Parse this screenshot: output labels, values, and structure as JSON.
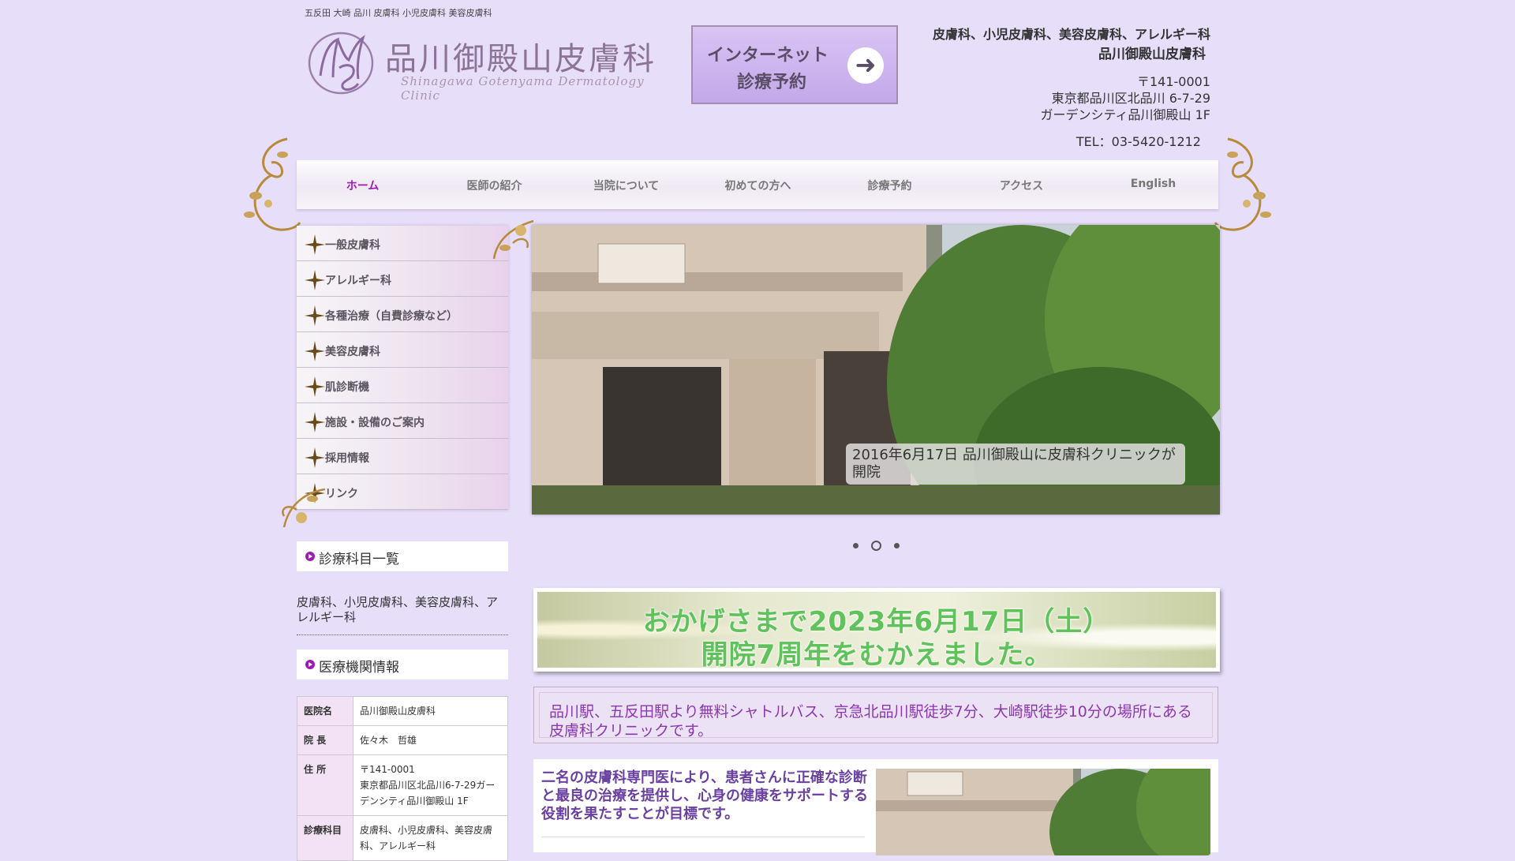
{
  "header": {
    "keywords": "五反田 大崎 品川 皮膚科 小児皮膚科 美容皮膚科",
    "logo_name": "品川御殿山皮膚科",
    "logo_sub": "Shinagawa Gotenyama Dermatology Clinic",
    "reserve_line1": "インターネット",
    "reserve_line2": "診療予約",
    "reserve_arrow": "➜",
    "depts": "皮膚科、小児皮膚科、美容皮膚科、アレルギー科",
    "clinic_name": "品川御殿山皮膚科",
    "postal": "〒141-0001",
    "address1": "東京都品川区北品川 6-7-29",
    "address2": "ガーデンシティ品川御殿山 1F",
    "tel": "TEL：03-5420-1212"
  },
  "nav": {
    "items": [
      "ホーム",
      "医師の紹介",
      "当院について",
      "初めての方へ",
      "診療予約",
      "アクセス",
      "English"
    ],
    "active_index": 0
  },
  "side_menu": {
    "items": [
      "一般皮膚科",
      "アレルギー科",
      "各種治療（自費診療など）",
      "美容皮膚科",
      "肌診断機",
      "施設・設備のご案内",
      "採用情報",
      "リンク"
    ]
  },
  "slider": {
    "caption": "2016年6月17日 品川御殿山に皮膚科クリニックが開院",
    "dots": 3,
    "active_dot": 1
  },
  "departments": {
    "title": "診療科目一覧",
    "text": "皮膚科、小児皮膚科、美容皮膚科、アレルギー科"
  },
  "institution": {
    "title": "医療機関情報",
    "rows": [
      {
        "key": "医院名",
        "value": "品川御殿山皮膚科"
      },
      {
        "key": "院 長",
        "value": "佐々木　哲雄"
      },
      {
        "key": "住 所",
        "value": "〒141-0001\n東京都品川区北品川6-7-29ガーデンシティ品川御殿山 1F"
      },
      {
        "key": "診療科目",
        "value": "皮膚科、小児皮膚科、美容皮膚科、アレルギー科"
      }
    ]
  },
  "banner": {
    "line1": "おかげさまで2023年6月17日（土）",
    "line2": "開院7周年をむかえました。"
  },
  "access_text": "品川駅、五反田駅より無料シャトルバス、京急北品川駅徒歩7分、大崎駅徒歩10分の場所にある皮膚科クリニックです。",
  "mission_text": "二名の皮膚科専門医により、患者さんに正確な診断と最良の治療を提供し、心身の健康をサポートする役割を果たすことが目標です。",
  "colors": {
    "background": "#e7defa",
    "accent_purple": "#9d1ab3",
    "gold": "#b88a3c"
  }
}
